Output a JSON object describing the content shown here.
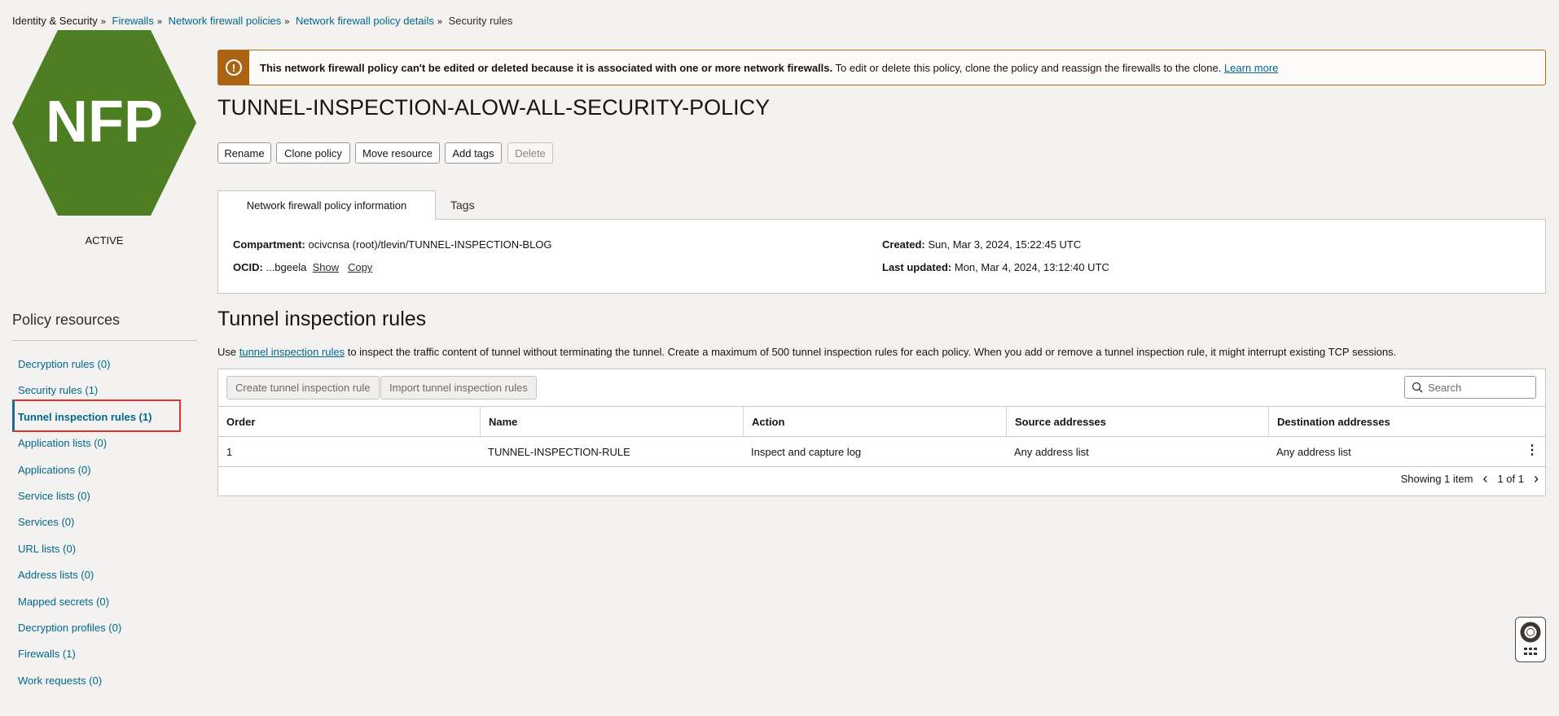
{
  "breadcrumb": [
    {
      "label": "Identity & Security",
      "link": false
    },
    {
      "label": "Firewalls",
      "link": true
    },
    {
      "label": "Network firewall policies",
      "link": true
    },
    {
      "label": "Network firewall policy details",
      "link": true
    },
    {
      "label": "Security rules",
      "link": false
    }
  ],
  "logo": {
    "text": "NFP",
    "color": "#4e7e22"
  },
  "status": "ACTIVE",
  "sidebar": {
    "title": "Policy resources",
    "items": [
      {
        "label": "Decryption rules (0)"
      },
      {
        "label": "Security rules (1)"
      },
      {
        "label": "Tunnel inspection rules (1)",
        "active": true
      },
      {
        "label": "Application lists (0)"
      },
      {
        "label": "Applications (0)"
      },
      {
        "label": "Service lists (0)"
      },
      {
        "label": "Services (0)"
      },
      {
        "label": "URL lists (0)"
      },
      {
        "label": "Address lists (0)"
      },
      {
        "label": "Mapped secrets (0)"
      },
      {
        "label": "Decryption profiles (0)"
      },
      {
        "label": "Firewalls (1)"
      },
      {
        "label": "Work requests (0)"
      }
    ]
  },
  "banner": {
    "bold": "This network firewall policy can't be edited or deleted because it is associated with one or more network firewalls.",
    "text": " To edit or delete this policy, clone the policy and reassign the firewalls to the clone. ",
    "link": "Learn more"
  },
  "title": "TUNNEL-INSPECTION-ALOW-ALL-SECURITY-POLICY",
  "actions": {
    "rename": "Rename",
    "clone": "Clone policy",
    "move": "Move resource",
    "tags": "Add tags",
    "delete": "Delete"
  },
  "tabs": {
    "info": "Network firewall policy information",
    "tags": "Tags"
  },
  "info": {
    "compartment_label": "Compartment:",
    "compartment": "ocivcnsa (root)/tlevin/TUNNEL-INSPECTION-BLOG",
    "ocid_label": "OCID:",
    "ocid": "...bgeela",
    "show": "Show",
    "copy": "Copy",
    "created_label": "Created:",
    "created": "Sun, Mar 3, 2024, 15:22:45 UTC",
    "updated_label": "Last updated:",
    "updated": "Mon, Mar 4, 2024, 13:12:40 UTC"
  },
  "section": {
    "title": "Tunnel inspection rules",
    "desc_pre": "Use ",
    "desc_link": "tunnel inspection rules",
    "desc_post": " to inspect the traffic content of tunnel without terminating the tunnel. Create a maximum of 500 tunnel inspection rules for each policy. When you add or remove a tunnel inspection rule, it might interrupt existing TCP sessions."
  },
  "table": {
    "create": "Create tunnel inspection rule",
    "import": "Import tunnel inspection rules",
    "search_placeholder": "Search",
    "columns": [
      "Order",
      "Name",
      "Action",
      "Source addresses",
      "Destination addresses"
    ],
    "rows": [
      [
        "1",
        "TUNNEL-INSPECTION-RULE",
        "Inspect and capture log",
        "Any address list",
        "Any address list"
      ]
    ],
    "showing": "Showing 1 item",
    "page": "1 of 1"
  }
}
